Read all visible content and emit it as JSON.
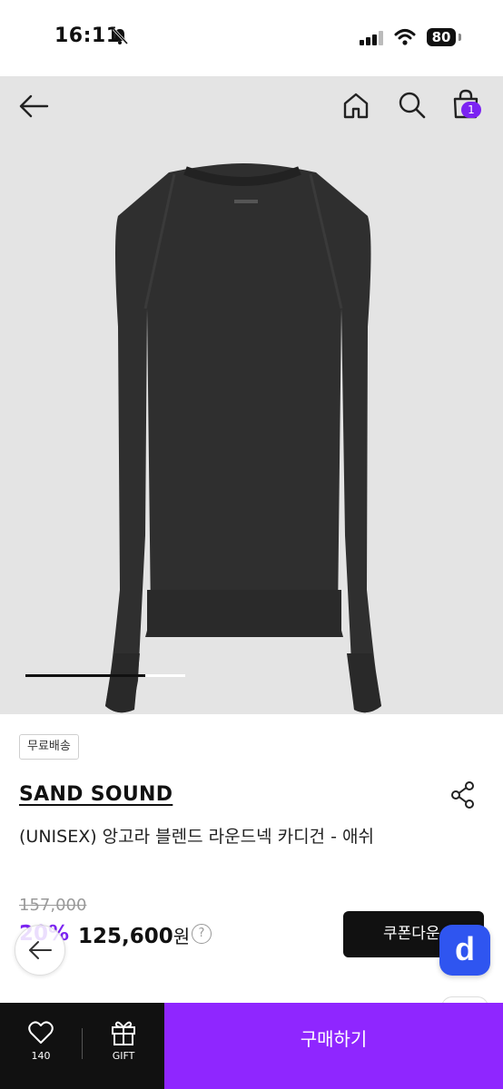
{
  "status_bar": {
    "time": "16:11",
    "battery": "80",
    "icons": [
      "bell-off-icon",
      "signal-icon",
      "wifi-icon",
      "battery-icon"
    ]
  },
  "nav": {
    "icons": [
      "back-arrow-icon",
      "home-icon",
      "search-icon",
      "cart-icon"
    ],
    "cart_count": "1"
  },
  "gallery": {
    "progress": 0.75,
    "accent": "#7b23f2"
  },
  "product": {
    "shipping_tag": "무료배송",
    "brand": "SAND SOUND",
    "name": "(UNISEX) 앙고라 블렌드 라운드넥 카디건 - 애쉬",
    "original_price": "157,000",
    "discount": "20%",
    "sale_price": "125,600",
    "currency": "원",
    "help": "?",
    "coupon_label": "쿠폰다운"
  },
  "floating": {
    "d_label": "d",
    "d_color": "#2f55f0"
  },
  "bottom_bar": {
    "like_count": "140",
    "gift_label": "GIFT",
    "buy_label": "구매하기",
    "buy_color": "#8f26ff"
  }
}
